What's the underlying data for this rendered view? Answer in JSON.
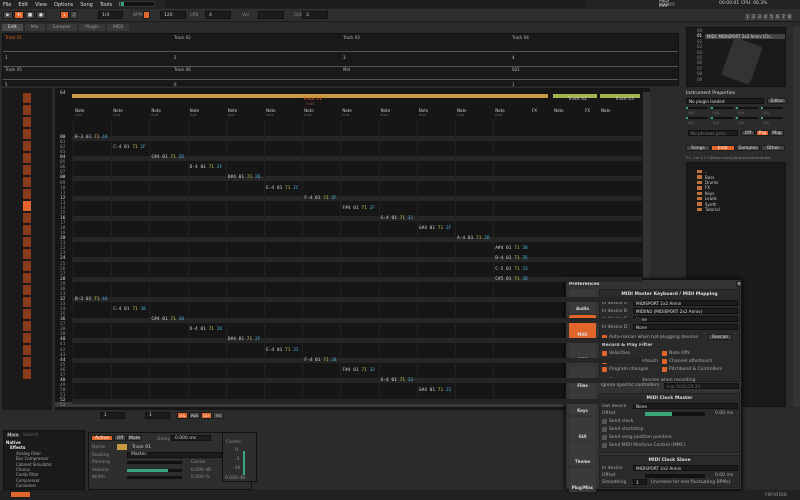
{
  "menu": [
    "File",
    "Edit",
    "View",
    "Options",
    "Song",
    "Tools",
    "Help"
  ],
  "topbar": {
    "midi_map": "MIDI MAP",
    "time": "00:00:01",
    "cpu": "CPU: 06.3%",
    "page_buttons": [
      "1",
      "2",
      "3",
      "4",
      "5",
      "6",
      "7",
      "8"
    ]
  },
  "toolbar": {
    "edit_step": "1/4",
    "bpm_label": "BPM",
    "bpm": "120",
    "lpb_label": "LPB",
    "lpb": "4",
    "vol_label": "Vol",
    "oct_label": "Oct",
    "oct": "3"
  },
  "tabs": [
    "Edit",
    "Mix",
    "Sampler",
    "Plugin",
    "MIDI"
  ],
  "matrix": {
    "row1": [
      "Track 01",
      "Track 02",
      "Track 03",
      "Track 04"
    ],
    "row1_nums": [
      "1",
      "2",
      "3",
      "4"
    ],
    "row2": [
      "Track 05",
      "Track 06",
      "Mst",
      "S01"
    ],
    "row2_nums": [
      "5",
      "6",
      "",
      "1"
    ]
  },
  "pattern": {
    "lines": "64",
    "track1": "Track 01",
    "track1_sub": "FLAT",
    "track2": "Track 02",
    "track3": "Track 03",
    "column_label": "Note",
    "fx_label": "FX",
    "column_sub": "FLAT",
    "notes": [
      [
        0,
        0,
        "B-3",
        "01",
        "71",
        "44"
      ],
      [
        2,
        1,
        "C-4",
        "01",
        "71",
        "2F"
      ],
      [
        4,
        2,
        "C#4",
        "01",
        "71",
        "2D"
      ],
      [
        6,
        3,
        "D-4",
        "01",
        "71",
        "2F"
      ],
      [
        8,
        4,
        "D#4",
        "01",
        "71",
        "2D"
      ],
      [
        10,
        5,
        "E-4",
        "01",
        "71",
        "2C"
      ],
      [
        12,
        6,
        "F-4",
        "01",
        "71",
        "2F"
      ],
      [
        14,
        7,
        "F#4",
        "01",
        "71",
        "2F"
      ],
      [
        16,
        8,
        "G-4",
        "01",
        "71",
        "31"
      ],
      [
        18,
        9,
        "G#4",
        "01",
        "71",
        "2F"
      ],
      [
        20,
        10,
        "A-4",
        "01",
        "71",
        "2D"
      ],
      [
        22,
        11,
        "A#4",
        "01",
        "71",
        "30"
      ],
      [
        24,
        11,
        "B-4",
        "01",
        "71",
        "35"
      ],
      [
        26,
        11,
        "C-5",
        "01",
        "71",
        "33"
      ],
      [
        28,
        11,
        "C#5",
        "01",
        "71",
        "2D"
      ],
      [
        32,
        0,
        "B-3",
        "01",
        "71",
        "44"
      ],
      [
        34,
        1,
        "C-4",
        "01",
        "71",
        "30"
      ],
      [
        36,
        2,
        "C#4",
        "01",
        "71",
        "30"
      ],
      [
        38,
        3,
        "D-4",
        "01",
        "71",
        "2D"
      ],
      [
        40,
        4,
        "D#4",
        "01",
        "71",
        "2F"
      ],
      [
        42,
        5,
        "E-4",
        "01",
        "71",
        "32"
      ],
      [
        44,
        6,
        "F-4",
        "01",
        "71",
        "34"
      ],
      [
        46,
        7,
        "F#4",
        "01",
        "71",
        "32"
      ],
      [
        48,
        8,
        "G-4",
        "01",
        "71",
        "32"
      ],
      [
        50,
        9,
        "G#4",
        "01",
        "71",
        "31"
      ]
    ]
  },
  "instruments": {
    "items": [
      "00",
      "01",
      "02",
      "03",
      "04",
      "05",
      "06",
      "07",
      "08",
      "09"
    ],
    "selected_name": "MIDI: MIDISPORT 2x2 Anniv (Ch..."
  },
  "inst_props": {
    "title": "Instrument Properties",
    "plugin": "No plugin loaded",
    "editor": "Editor",
    "na": "N/A",
    "phrases": "No phrases pres..",
    "off": "Off",
    "prg": "Prg",
    "map": "Map"
  },
  "browser": {
    "tabs": [
      "Songs",
      "Instr",
      "Samples",
      "Other"
    ],
    "path": "F1...ne 3.2.1\\Resources\\Library\\Instruments\\",
    "items": [
      "..",
      "Bass",
      "Drums",
      "FX",
      "Keys",
      "Leads",
      "Synth",
      "Tutorial"
    ]
  },
  "prefs": {
    "title": "Preferences",
    "sidebar": [
      "Audio",
      "MIDI",
      "OSC",
      "Files",
      "Keys",
      "GUI",
      "Theme",
      "Plug/Misc"
    ],
    "mapping_title": "MIDI Master Keyboard / MIDI Mapping",
    "devices": [
      [
        "In device A",
        "MIDISPORT 2x2 Anniv"
      ],
      [
        "In device B",
        "MIDIIN2 (MIDISPORT 2x2 Anniv)"
      ],
      [
        "In device C",
        "None"
      ],
      [
        "In device D",
        "None"
      ]
    ],
    "autorescan": "Auto-rescan when hot-plugging devices",
    "rescan": "Rescan",
    "filter_title": "Record & Play Filter",
    "filters": [
      "Velocities",
      "Note Offs",
      "Polyphonic aftertouch",
      "Channel aftertouch",
      "Program changes",
      "Pitchbend & Controllers"
    ],
    "compensate": "Compensate latencies when recording",
    "ignore_label": "Ignore specific controllers",
    "ignore_placeholder": "e.g. 0x16,29,23",
    "clock_master_title": "MIDI Clock Master",
    "out_label": "Out device",
    "out_value": "None",
    "offset_label": "Offset",
    "master_offset": "0.00 ms",
    "master_offset_fill": 0.45,
    "master_opts": [
      "Send clock",
      "Send start/stop",
      "Send song position pointers",
      "Send MIDI Machine Control (MMC)"
    ],
    "clock_slave_title": "MIDI Clock Slave",
    "in_label": "In device",
    "in_value": "MIDISPORT 2x2 Anniv",
    "slave_offset": "0.00 ms",
    "smoothing_label": "Smoothing",
    "smoothing": "1",
    "smoothing_hint": "(increase for less fluctuating BPMs)"
  },
  "dsp": {
    "more": "More",
    "search_placeholder": "Search",
    "tree": [
      "Native",
      "Effects",
      "Analog Filter",
      "Bus Compressor",
      "Cabinet Simulator",
      "Chorus",
      "Comb Filter",
      "Compressor",
      "Convolver"
    ]
  },
  "track_dsp": {
    "active": "Active",
    "off": "Off",
    "mute": "Mute",
    "delay_label": "Delay",
    "delay": "0.000 ms",
    "name_label": "Name",
    "name": "Track 01",
    "routing_label": "Routing",
    "routing": "Master",
    "panning_label": "Panning",
    "panning": "Center",
    "volume_label": "Volume",
    "volume": "0.000 dB",
    "width_label": "Width",
    "width": "0.000 %",
    "meter_center": "Center",
    "meter_ticks": [
      "0",
      "-3",
      "-36"
    ],
    "meter_db": "0.000 dB",
    "volume_fill": 0.75
  },
  "pattern_toolbar": {
    "step": "1",
    "octave": "1",
    "buttons": [
      "VOL",
      "PAN",
      "DLY",
      "FX"
    ]
  },
  "logo": "renoise",
  "colors": {
    "accent": "#e2652c",
    "track_header": "#c79a40",
    "volume": "#c9c050",
    "fx": "#4ab0d8",
    "slider": "#3aa57a"
  }
}
